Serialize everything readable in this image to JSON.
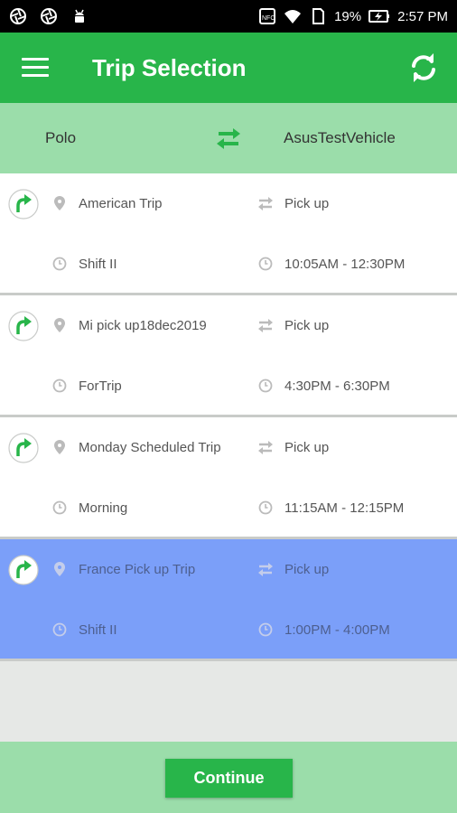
{
  "status_bar": {
    "battery_percent": "19%",
    "time": "2:57 PM",
    "icons": [
      "aperture-icon",
      "aperture-icon",
      "android-icon",
      "nfc-icon",
      "wifi-icon",
      "sim-icon",
      "battery-charging-icon"
    ]
  },
  "header": {
    "title": "Trip Selection",
    "menu_icon": "menu-icon",
    "refresh_icon": "refresh-icon"
  },
  "route": {
    "from": "Polo",
    "to": "AsusTestVehicle",
    "swap_icon": "swap-icon"
  },
  "trips": [
    {
      "name": "American Trip",
      "type": "Pick up",
      "shift": "Shift II",
      "time": "10:05AM - 12:30PM",
      "selected": false
    },
    {
      "name": "Mi pick up18dec2019",
      "type": "Pick up",
      "shift": "ForTrip",
      "time": "4:30PM - 6:30PM",
      "selected": false
    },
    {
      "name": "Monday Scheduled Trip",
      "type": "Pick up",
      "shift": "Morning",
      "time": "11:15AM - 12:15PM",
      "selected": false
    },
    {
      "name": "France Pick up Trip",
      "type": "Pick up",
      "shift": "Shift II",
      "time": "1:00PM - 4:00PM",
      "selected": true
    }
  ],
  "footer": {
    "continue_label": "Continue"
  },
  "colors": {
    "primary_green": "#28b54a",
    "light_green": "#9bddaa",
    "selected_blue": "#7b9ff9"
  }
}
